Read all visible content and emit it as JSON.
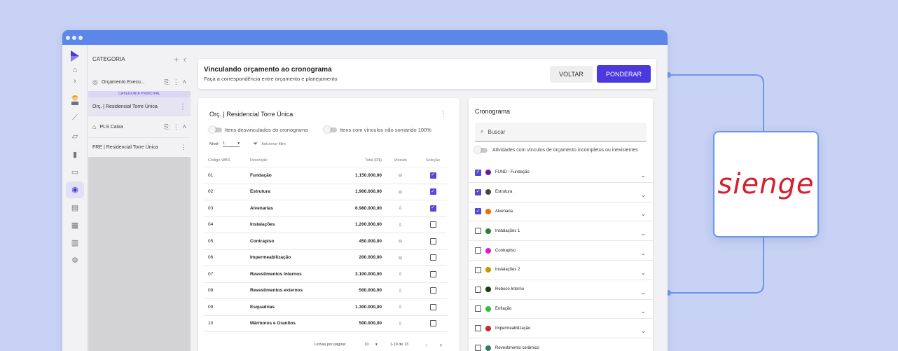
{
  "app": {
    "category_panel": {
      "header": "CATEGORIA",
      "items": [
        {
          "label": "Orçamento Execu..."
        },
        {
          "label": "PLS Caixa"
        },
        {
          "label": "FRE | Residencial Torre Única"
        }
      ],
      "principal_label": "CATEGORIA PRINCIPAL",
      "selected_item": "Orç. | Residencial Torre Única"
    },
    "banner": {
      "title": "Vinculando orçamento ao cronograma",
      "subtitle": "Faça a correspondência entre orçamento e planejamento",
      "back_label": "VOLTAR",
      "ponderar_label": "PONDERAR"
    },
    "budget": {
      "title": "Orç. | Residencial Torre Única",
      "toggle_unlinked": "Itens desvinculados do cronograma",
      "toggle_not_100": "Itens com vínculos não somando 100%",
      "nivel_label": "Nível:",
      "nivel_value": "1",
      "filter_label": "Adicionar filtro",
      "columns": [
        "Código WBS",
        "Descrição",
        "Total (R$)",
        "Vínculo",
        "Seleção"
      ],
      "rows": [
        {
          "code": "01",
          "desc": "Fundação",
          "total": "1.150.000,00",
          "link": "link",
          "sel": true
        },
        {
          "code": "02",
          "desc": "Estrutura",
          "total": "1.900.000,00",
          "link": "link",
          "sel": true
        },
        {
          "code": "03",
          "desc": "Alvenarias",
          "total": "6.980.000,00",
          "link": "arrow",
          "sel": true
        },
        {
          "code": "04",
          "desc": "Instalações",
          "total": "1.200.000,00",
          "link": "arrow",
          "sel": false
        },
        {
          "code": "05",
          "desc": "Contrapiso",
          "total": "450.000,00",
          "link": "link",
          "sel": false
        },
        {
          "code": "06",
          "desc": "Impermeabilização",
          "total": "200.000,00",
          "link": "link",
          "sel": false
        },
        {
          "code": "07",
          "desc": "Revestimentos Internos",
          "total": "3.100.000,00",
          "link": "arrow",
          "sel": false
        },
        {
          "code": "08",
          "desc": "Revestimentos externos",
          "total": "500.000,00",
          "link": "arrow",
          "sel": false
        },
        {
          "code": "09",
          "desc": "Esquadrias",
          "total": "1.300.000,00",
          "link": "arrow",
          "sel": false
        },
        {
          "code": "10",
          "desc": "Mármores e Granitos",
          "total": "500.000,00",
          "link": "arrow",
          "sel": false
        }
      ],
      "footer": {
        "rows_per_page_label": "Linhas por página:",
        "rows_per_page": "10",
        "range": "1-10 de 13"
      }
    },
    "cronograma": {
      "title": "Cronograma",
      "search_placeholder": "Buscar",
      "toggle_label": "Atividades com vínculos de orçamento incompletos ou inexistentes",
      "activities": [
        {
          "label": "FUND - Fundação",
          "color": "#6a1b9a",
          "checked": true
        },
        {
          "label": "Estrutura",
          "color": "#444444",
          "checked": true
        },
        {
          "label": "Alvenaria",
          "color": "#ef6c00",
          "checked": true
        },
        {
          "label": "Instalações 1",
          "color": "#2e7d32",
          "checked": false
        },
        {
          "label": "Contrapiso",
          "color": "#d81bd8",
          "checked": false
        },
        {
          "label": "Instalações 2",
          "color": "#c49a00",
          "checked": false
        },
        {
          "label": "Reboco Interno",
          "color": "#1b3a1b",
          "checked": false
        },
        {
          "label": "Enfiação",
          "color": "#2bbf3a",
          "checked": false
        },
        {
          "label": "Impermeabilização",
          "color": "#c62828",
          "checked": false
        },
        {
          "label": "Revestimento cerâmico",
          "color": "#2e7d6a",
          "checked": false
        }
      ]
    }
  },
  "brand": {
    "logo_text": "sienge",
    "accent": "#4b38de",
    "connector": "#6b97ea"
  }
}
